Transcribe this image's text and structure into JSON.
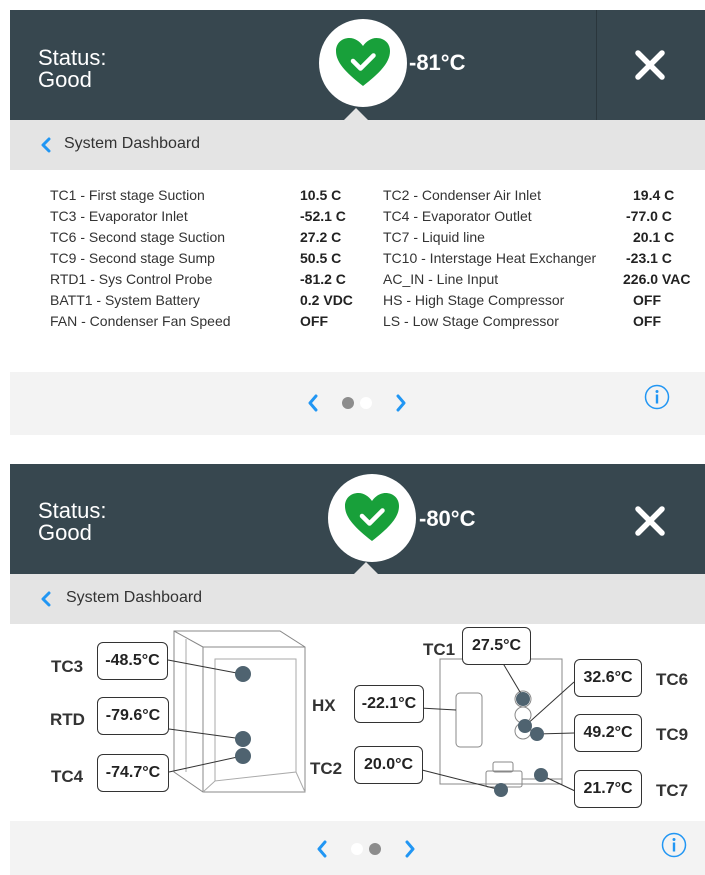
{
  "colors": {
    "header_bg": "#37474f",
    "accent": "#2196f3",
    "status_good": "#18a03a",
    "subbar_bg": "#e4e4e4",
    "footer_bg": "#f3f3f3"
  },
  "screens": [
    {
      "status_label": "Status:",
      "status_value": "Good",
      "status_icon": "heart-check-icon",
      "temperature": "-81°C",
      "close_icon": "close-icon",
      "breadcrumb": "System Dashboard",
      "pager": {
        "total": 2,
        "current": 1
      },
      "info_icon": "info-icon",
      "readings_left": [
        {
          "label": "TC1 - First stage Suction",
          "value": "10.5 C"
        },
        {
          "label": "TC3 - Evaporator Inlet",
          "value": "-52.1 C"
        },
        {
          "label": "TC6 - Second stage Suction",
          "value": "27.2 C"
        },
        {
          "label": "TC9 - Second stage Sump",
          "value": "50.5 C"
        },
        {
          "label": "RTD1 - Sys Control Probe",
          "value": "-81.2 C"
        },
        {
          "label": "BATT1 - System Battery",
          "value": "0.2 VDC"
        },
        {
          "label": "FAN - Condenser Fan Speed",
          "value": "OFF"
        }
      ],
      "readings_right": [
        {
          "label": "TC2 - Condenser Air Inlet",
          "value": "19.4 C"
        },
        {
          "label": "TC4 - Evaporator Outlet",
          "value": "-77.0 C"
        },
        {
          "label": "TC7 - Liquid line",
          "value": "20.1 C"
        },
        {
          "label": "TC10 - Interstage Heat Exchanger",
          "value": "-23.1 C"
        },
        {
          "label": "AC_IN - Line Input",
          "value": "226.0 VAC"
        },
        {
          "label": "HS - High Stage Compressor",
          "value": "OFF"
        },
        {
          "label": "LS - Low Stage Compressor",
          "value": "OFF"
        }
      ]
    },
    {
      "status_label": "Status:",
      "status_value": "Good",
      "status_icon": "heart-check-icon",
      "temperature": "-80°C",
      "close_icon": "close-icon",
      "breadcrumb": "System Dashboard",
      "pager": {
        "total": 2,
        "current": 2
      },
      "info_icon": "info-icon",
      "sensors": {
        "TC3": {
          "label": "TC3",
          "value": "-48.5°C"
        },
        "RTD": {
          "label": "RTD",
          "value": "-79.6°C"
        },
        "TC4": {
          "label": "TC4",
          "value": "-74.7°C"
        },
        "TC1": {
          "label": "TC1",
          "value": "27.5°C"
        },
        "HX": {
          "label": "HX",
          "value": "-22.1°C"
        },
        "TC2": {
          "label": "TC2",
          "value": "20.0°C"
        },
        "TC6": {
          "label": "TC6",
          "value": "32.6°C"
        },
        "TC9": {
          "label": "TC9",
          "value": "49.2°C"
        },
        "TC7": {
          "label": "TC7",
          "value": "21.7°C"
        }
      }
    }
  ]
}
